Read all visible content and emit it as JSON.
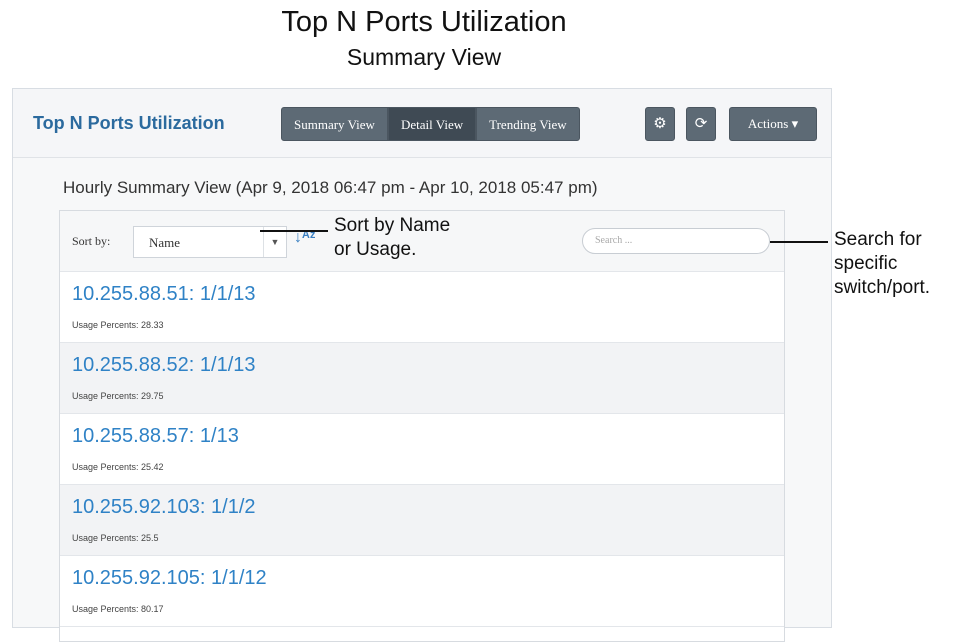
{
  "figure": {
    "title": "Top N Ports Utilization",
    "subtitle": "Summary View"
  },
  "widget": {
    "title": "Top N Ports Utilization",
    "view_buttons": [
      "Summary View",
      "Detail View",
      "Trending View"
    ],
    "settings_icon": "gear-icon",
    "refresh_icon": "refresh-icon",
    "actions_label": "Actions ▾",
    "range_text": "Hourly Summary View (Apr 9, 2018 06:47 pm - Apr 10, 2018 05:47 pm)",
    "sort_label": "Sort by:",
    "sort_value": "Name",
    "sort_order_icon": "sort-alpha-icon",
    "search_placeholder": "Search ...",
    "rows": [
      {
        "name": "10.255.88.51: 1/1/13",
        "usage": "Usage Percents: 28.33"
      },
      {
        "name": "10.255.88.52: 1/1/13",
        "usage": "Usage Percents: 29.75"
      },
      {
        "name": "10.255.88.57: 1/13",
        "usage": "Usage Percents: 25.42"
      },
      {
        "name": "10.255.92.103: 1/1/2",
        "usage": "Usage Percents: 25.5"
      },
      {
        "name": "10.255.92.105: 1/1/12",
        "usage": "Usage Percents: 80.17"
      }
    ]
  },
  "annotations": {
    "sort": [
      "Sort by Name",
      "or Usage."
    ],
    "search": [
      "Search for",
      "specific",
      "switch/port."
    ]
  },
  "colors": {
    "accent": "#2f82c6",
    "button": "#5d6a75"
  }
}
